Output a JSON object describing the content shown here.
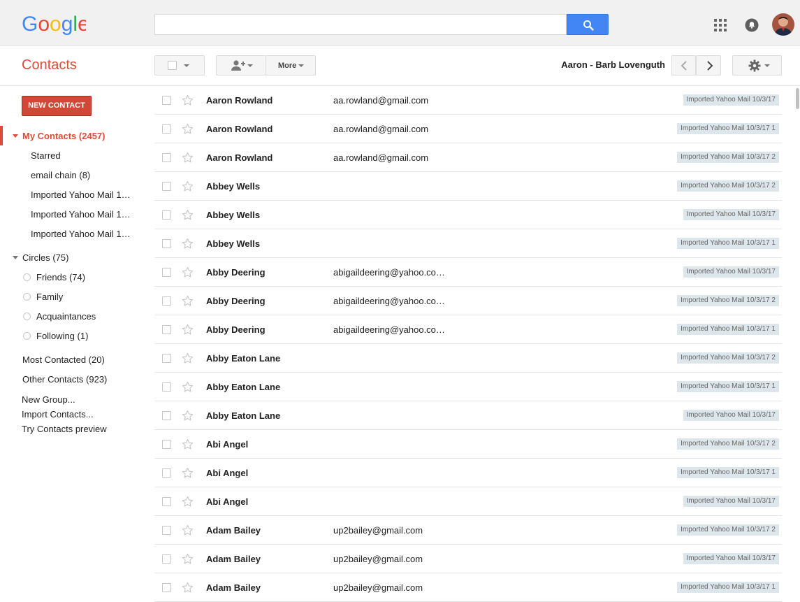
{
  "header": {
    "logo_text": "Google",
    "search": {
      "value": "",
      "placeholder": ""
    }
  },
  "toolbar": {
    "app_title": "Contacts",
    "more_label": "More",
    "range_label": "Aaron - Barb Lovenguth"
  },
  "sidebar": {
    "new_contact_label": "NEW CONTACT",
    "my_contacts": "My Contacts (2457)",
    "my_contacts_items": [
      "Starred",
      "email chain (8)",
      "Imported Yahoo Mail 1…",
      "Imported Yahoo Mail 1…",
      "Imported Yahoo Mail 1…"
    ],
    "circles": "Circles (75)",
    "circle_items": [
      "Friends (74)",
      "Family",
      "Acquaintances",
      "Following (1)"
    ],
    "most_contacted": "Most Contacted (20)",
    "other_contacts": "Other Contacts (923)",
    "links": [
      "New Group...",
      "Import Contacts...",
      "Try Contacts preview"
    ]
  },
  "contacts": [
    {
      "name": "Aaron Rowland",
      "email": "aa.rowland@gmail.com",
      "label": "Imported Yahoo Mail 10/3/17"
    },
    {
      "name": "Aaron Rowland",
      "email": "aa.rowland@gmail.com",
      "label": "Imported Yahoo Mail 10/3/17 1"
    },
    {
      "name": "Aaron Rowland",
      "email": "aa.rowland@gmail.com",
      "label": "Imported Yahoo Mail 10/3/17 2"
    },
    {
      "name": "Abbey Wells",
      "email": "",
      "label": "Imported Yahoo Mail 10/3/17 2"
    },
    {
      "name": "Abbey Wells",
      "email": "",
      "label": "Imported Yahoo Mail 10/3/17"
    },
    {
      "name": "Abbey Wells",
      "email": "",
      "label": "Imported Yahoo Mail 10/3/17 1"
    },
    {
      "name": "Abby Deering",
      "email": "abigaildeering@yahoo.co…",
      "label": "Imported Yahoo Mail 10/3/17"
    },
    {
      "name": "Abby Deering",
      "email": "abigaildeering@yahoo.co…",
      "label": "Imported Yahoo Mail 10/3/17 2"
    },
    {
      "name": "Abby Deering",
      "email": "abigaildeering@yahoo.co…",
      "label": "Imported Yahoo Mail 10/3/17 1"
    },
    {
      "name": "Abby Eaton Lane",
      "email": "",
      "label": "Imported Yahoo Mail 10/3/17 2"
    },
    {
      "name": "Abby Eaton Lane",
      "email": "",
      "label": "Imported Yahoo Mail 10/3/17 1"
    },
    {
      "name": "Abby Eaton Lane",
      "email": "",
      "label": "Imported Yahoo Mail 10/3/17"
    },
    {
      "name": "Abi Angel",
      "email": "",
      "label": "Imported Yahoo Mail 10/3/17 2"
    },
    {
      "name": "Abi Angel",
      "email": "",
      "label": "Imported Yahoo Mail 10/3/17 1"
    },
    {
      "name": "Abi Angel",
      "email": "",
      "label": "Imported Yahoo Mail 10/3/17"
    },
    {
      "name": "Adam Bailey",
      "email": "up2bailey@gmail.com",
      "label": "Imported Yahoo Mail 10/3/17 2"
    },
    {
      "name": "Adam Bailey",
      "email": "up2bailey@gmail.com",
      "label": "Imported Yahoo Mail 10/3/17"
    },
    {
      "name": "Adam Bailey",
      "email": "up2bailey@gmail.com",
      "label": "Imported Yahoo Mail 10/3/17 1"
    }
  ],
  "colors": {
    "accent_red": "#dd4b39",
    "new_contact_bg": "#d14836",
    "search_blue": "#4285f4",
    "label_bg": "#dde6ea"
  },
  "icons": [
    "search-icon",
    "apps-grid-icon",
    "notifications-bell-icon",
    "add-person-icon",
    "chevron-left-icon",
    "chevron-right-icon",
    "gear-icon",
    "star-icon"
  ]
}
